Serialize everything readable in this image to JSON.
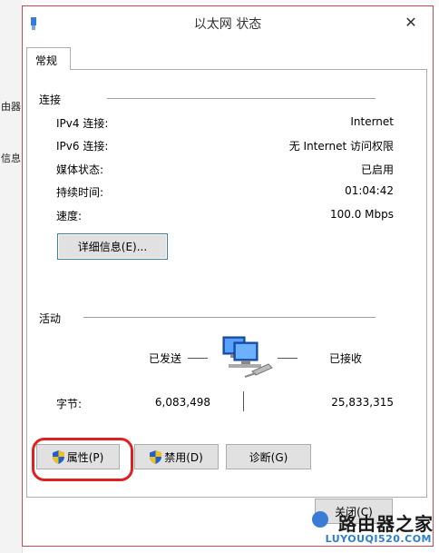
{
  "window": {
    "title": "以太网 状态",
    "close_glyph": "✕"
  },
  "tabs": [
    {
      "label": "常规"
    }
  ],
  "connection": {
    "group_label": "连接",
    "rows": [
      {
        "label": "IPv4 连接:",
        "value": "Internet"
      },
      {
        "label": "IPv6 连接:",
        "value": "无 Internet 访问权限"
      },
      {
        "label": "媒体状态:",
        "value": "已启用"
      },
      {
        "label": "持续时间:",
        "value": "01:04:42"
      },
      {
        "label": "速度:",
        "value": "100.0 Mbps"
      }
    ],
    "details_button": "详细信息(E)..."
  },
  "activity": {
    "group_label": "活动",
    "sent_label": "已发送",
    "received_label": "已接收",
    "bytes_label": "字节:",
    "bytes_sent": "6,083,498",
    "bytes_received": "25,833,315"
  },
  "buttons": {
    "properties": "属性(P)",
    "disable": "禁用(D)",
    "diagnose": "诊断(G)",
    "close": "关闭(C)"
  },
  "background": {
    "left_fragments": [
      "由器",
      "信息"
    ]
  },
  "watermark": {
    "main": "路由器之家",
    "sub": "LUYOUQI520.COM"
  },
  "colors": {
    "window_border": "#c74b50",
    "highlight": "#e02020",
    "button_bg": "#e1e1e1",
    "focus_border": "#3c7fb1",
    "watermark_blue": "#2a7fd2"
  }
}
